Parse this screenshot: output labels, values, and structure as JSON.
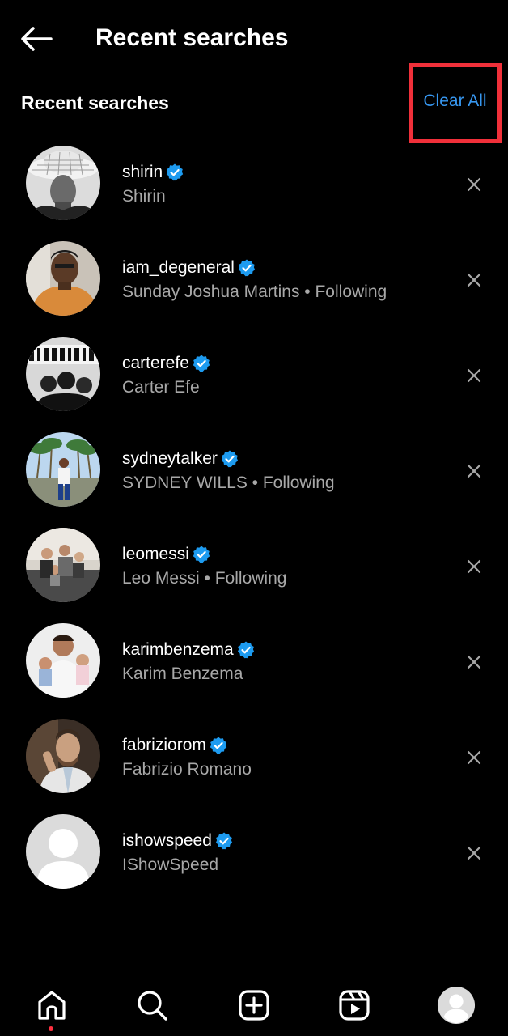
{
  "header": {
    "title": "Recent searches",
    "back_icon": "arrow-left-icon"
  },
  "section": {
    "title": "Recent searches",
    "clear_all_label": "Clear All",
    "highlight_color": "#f0303a"
  },
  "colors": {
    "background": "#000000",
    "primary_text": "#ffffff",
    "secondary_text": "#a8a8a8",
    "link": "#3797f0",
    "verified_badge": "#1d9bf0",
    "notification_dot": "#ff3040"
  },
  "results": [
    {
      "username": "shirin",
      "subtitle": "Shirin",
      "verified": true
    },
    {
      "username": "iam_degeneral",
      "subtitle": "Sunday Joshua Martins • Following",
      "verified": true
    },
    {
      "username": "carterefe",
      "subtitle": "Carter Efe",
      "verified": true
    },
    {
      "username": "sydneytalker",
      "subtitle": "SYDNEY WILLS • Following",
      "verified": true
    },
    {
      "username": "leomessi",
      "subtitle": "Leo Messi • Following",
      "verified": true
    },
    {
      "username": "karimbenzema",
      "subtitle": "Karim Benzema",
      "verified": true
    },
    {
      "username": "fabriziorom",
      "subtitle": "Fabrizio Romano",
      "verified": true
    },
    {
      "username": "ishowspeed",
      "subtitle": "IShowSpeed",
      "verified": true
    }
  ],
  "bottom_nav": [
    {
      "name": "home",
      "icon": "home-icon",
      "active": true
    },
    {
      "name": "search",
      "icon": "search-icon",
      "active": false
    },
    {
      "name": "create",
      "icon": "add-post-icon",
      "active": false
    },
    {
      "name": "reels",
      "icon": "reels-icon",
      "active": false
    },
    {
      "name": "profile",
      "icon": "profile-avatar-icon",
      "active": false
    }
  ]
}
